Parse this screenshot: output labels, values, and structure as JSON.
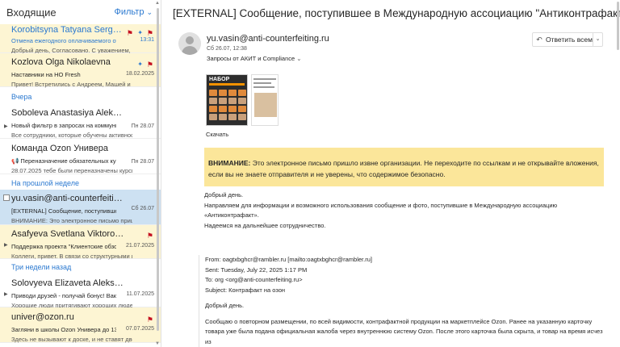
{
  "list": {
    "title": "Входящие",
    "filter_label": "Фильтр",
    "sections": {
      "yesterday": "Вчера",
      "last_week": "На прошлой неделе",
      "three_weeks": "Три недели назад"
    },
    "items": [
      {
        "sender": "Korobitsyna Tatyana Sergeev...",
        "subject": "Отмена ежегодного оплачиваемого отп",
        "date": "13:31",
        "preview": "Добрый день, Согласовано. С уважением, Короб..."
      },
      {
        "sender": "Kozlova Olga Nikolaevna",
        "subject": "Наставники на НО Fresh",
        "date": "18.02.2025",
        "preview": "Привет! Встретились с Андреем, Машей и Галей ..."
      },
      {
        "sender": "Soboleva Anastasiya Alekseе...",
        "subject": "Новый фильтр в запросах на коммуникац",
        "date": "Пн 28.07",
        "preview": "Все сотрудники, которые обучены активности, П..."
      },
      {
        "sender": "Команда Ozon Универа",
        "subject": "📢 Переназначение обязательных курсо",
        "date": "Пн 28.07",
        "preview": "28.07.2025 тебе были переназначены курсы: «П..."
      },
      {
        "sender": "yu.vasin@anti-counterfeiting....",
        "subject": "[EXTERNAL] Сообщение, поступившее в М",
        "date": "Сб 26.07",
        "preview": "ВНИМАНИЕ: Это электронное письмо пришло из..."
      },
      {
        "sender": "Asafyeva Svetlana Viktorovna",
        "subject": "Поддержка проекта \"Клиентские обзоры",
        "date": "21.07.2025",
        "preview": "Коллеги, привет. В связи со структурными измен..."
      },
      {
        "sender": "Solovyeva Elizaveta Alekseev...",
        "subject": "Приводи друзей - получай бонус! Ваканс",
        "date": "11.07.2025",
        "preview": "Хорошие люди притягивают хороших людей 😎 ..."
      },
      {
        "sender": "univer@ozon.ru",
        "subject": "Загляни в школы Ozon Универа до 13 и",
        "date": "07.07.2025",
        "preview": "Здесь не вызывают к доске, и не ставят двоек...."
      }
    ]
  },
  "message": {
    "subject": "[EXTERNAL] Сообщение, поступившее в Международную ассоциацию \"Антиконтрафакт\"",
    "from": "yu.vasin@anti-counterfeiting.ru",
    "sent": "Сб 26.07, 12:38",
    "tag": "Запросы от АКИТ и Compliance",
    "reply_all": "Ответить всем",
    "attachment_thumb_text": "НАБОР",
    "download": "Скачать",
    "warning_bold": "ВНИМАНИЕ:",
    "warning_text": " Это электронное письмо пришло извне организации. Не переходите по ссылкам и не открывайте вложения, если вы не знаете отправителя и не уверены, что содержимое безопасно.",
    "body": [
      "Добрый день.",
      "Направляем для информации и возможного использования сообщение и фото, поступившие в Международную ассоциацию «Антиконтрафакт».",
      "Надеемся на дальнейшее сотрудничество."
    ],
    "quote": {
      "from": "From: oagtxbghcr@rambler.ru [mailto:oagtxbghcr@rambler.ru]",
      "sent": "Sent: Tuesday, July 22, 2025 1:17 PM",
      "to": "To: org <org@anti-counterfeiting.ru>",
      "subject": "Subject: Контрафакт на озон",
      "greeting": "Добрый день.",
      "para": "Сообщаю о повторном размещении, по всей видимости, контрафактной продукции на маркетплейсе Ozon. Ранее на указанную карточку товара уже была подана официальная жалоба через внутреннюю систему Ozon. После этого карточка была скрыта, и товар на время исчез из"
    }
  },
  "colors": {
    "accent": "#2b79d0",
    "highlight": "#fdf5d3",
    "selected": "#cde1f2",
    "warning": "#fbe69a",
    "flag": "#c50f1f"
  }
}
